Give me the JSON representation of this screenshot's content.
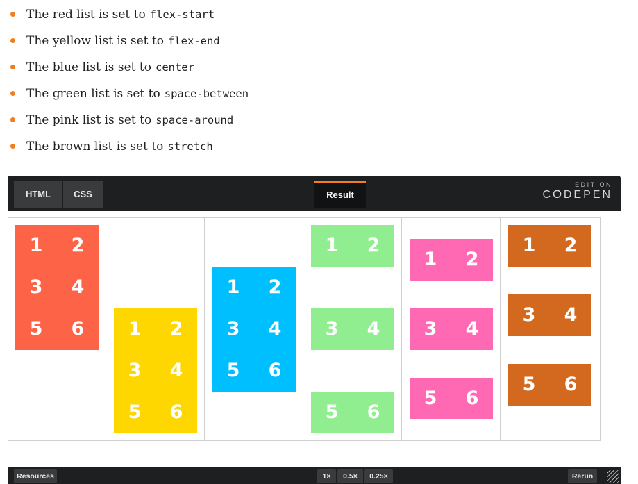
{
  "bullets": [
    {
      "prefix": "The red list is set to",
      "code": "flex-start"
    },
    {
      "prefix": "The yellow list is set to",
      "code": "flex-end"
    },
    {
      "prefix": "The blue list is set to",
      "code": "center"
    },
    {
      "prefix": "The green list is set to",
      "code": "space-between"
    },
    {
      "prefix": "The pink list is set to",
      "code": "space-around"
    },
    {
      "prefix": "The brown list is set to",
      "code": "stretch"
    }
  ],
  "embed": {
    "tabs": {
      "html": "HTML",
      "css": "CSS",
      "result": "Result"
    },
    "edit_on": "EDIT ON",
    "logo": "C⭘DEPEN",
    "footer": {
      "resources": "Resources",
      "zoom_1x": "1×",
      "zoom_05x": "0.5×",
      "zoom_025x": "0.25×",
      "rerun": "Rerun"
    }
  },
  "demo": {
    "numbers": [
      "1",
      "2",
      "3",
      "4",
      "5",
      "6"
    ],
    "colors": {
      "red": "#fd6346",
      "yellow": "#ffd700",
      "blue": "#00bfff",
      "green": "#90ee90",
      "pink": "#ff69b4",
      "brown": "#d2691e",
      "accent": "#f27e1f"
    }
  }
}
